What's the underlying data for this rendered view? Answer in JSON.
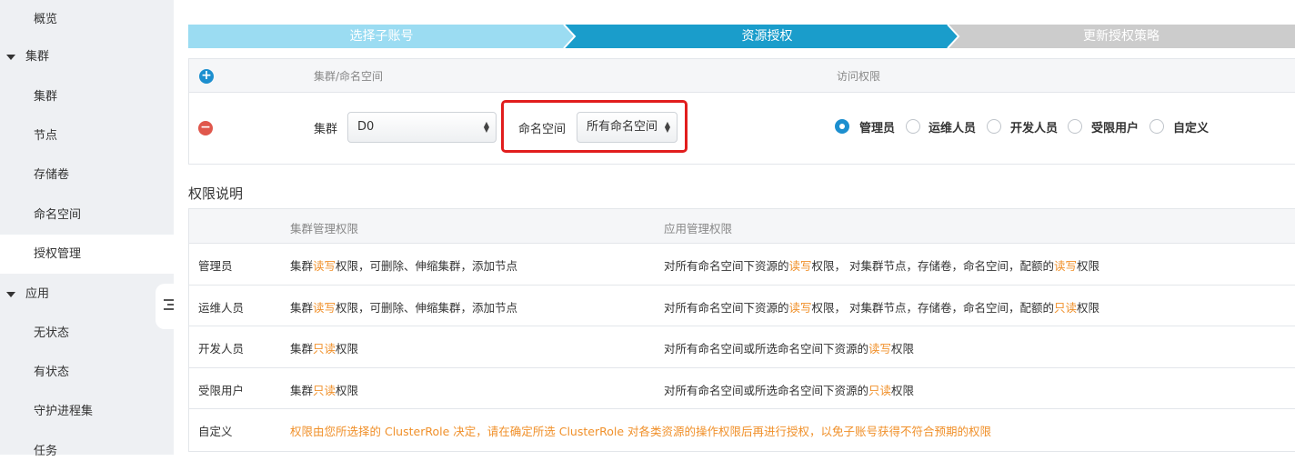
{
  "sidebar": {
    "items": [
      {
        "label": "概览",
        "type": "sub"
      },
      {
        "label": "集群",
        "type": "group"
      },
      {
        "label": "集群",
        "type": "sub"
      },
      {
        "label": "节点",
        "type": "sub"
      },
      {
        "label": "存储卷",
        "type": "sub"
      },
      {
        "label": "命名空间",
        "type": "sub"
      },
      {
        "label": "授权管理",
        "type": "sub",
        "active": true
      },
      {
        "label": "应用",
        "type": "group"
      },
      {
        "label": "无状态",
        "type": "sub"
      },
      {
        "label": "有状态",
        "type": "sub"
      },
      {
        "label": "守护进程集",
        "type": "sub"
      },
      {
        "label": "任务",
        "type": "sub"
      }
    ]
  },
  "steps": [
    {
      "label": "选择子账号",
      "state": "done"
    },
    {
      "label": "资源授权",
      "state": "current"
    },
    {
      "label": "更新授权策略",
      "state": "pending"
    }
  ],
  "auth": {
    "header": {
      "scope": "集群/命名空间",
      "access": "访问权限"
    },
    "row": {
      "cluster_label": "集群",
      "cluster_value": "D0",
      "namespace_label": "命名空间",
      "namespace_value": "所有命名空间",
      "roles": [
        {
          "label": "管理员",
          "checked": true
        },
        {
          "label": "运维人员",
          "checked": false
        },
        {
          "label": "开发人员",
          "checked": false
        },
        {
          "label": "受限用户",
          "checked": false
        },
        {
          "label": "自定义",
          "checked": false
        }
      ]
    }
  },
  "perm": {
    "title": "权限说明",
    "headers": [
      "",
      "集群管理权限",
      "应用管理权限"
    ],
    "rows": [
      {
        "role": "管理员",
        "cluster": [
          "集群",
          "读写",
          "权限，可删除、伸缩集群，添加节点"
        ],
        "app": [
          "对所有命名空间下资源的",
          "读写",
          "权限， 对集群节点，存储卷，命名空间，配额的",
          "读写",
          "权限"
        ]
      },
      {
        "role": "运维人员",
        "cluster": [
          "集群",
          "读写",
          "权限，可删除、伸缩集群，添加节点"
        ],
        "app": [
          "对所有命名空间下资源的",
          "读写",
          "权限， 对集群节点，存储卷，命名空间，配额的",
          "只读",
          "权限"
        ]
      },
      {
        "role": "开发人员",
        "cluster": [
          "集群",
          "只读",
          "权限"
        ],
        "app": [
          "对所有命名空间或所选命名空间下资源的",
          "读写",
          "权限"
        ]
      },
      {
        "role": "受限用户",
        "cluster": [
          "集群",
          "只读",
          "权限"
        ],
        "app": [
          "对所有命名空间或所选命名空间下资源的",
          "只读",
          "权限"
        ]
      },
      {
        "role": "自定义",
        "custom": "权限由您所选择的 ClusterRole 决定，请在确定所选 ClusterRole 对各类资源的操作权限后再进行授权，以免子账号获得不符合预期的权限"
      }
    ]
  },
  "colors": {
    "accent": "#1d8fcf",
    "step_done": "#9bdcf2",
    "step_current": "#1a9dcb",
    "step_pending": "#cccccc",
    "highlight": "#f0902a",
    "annotation": "#e11d1d"
  }
}
